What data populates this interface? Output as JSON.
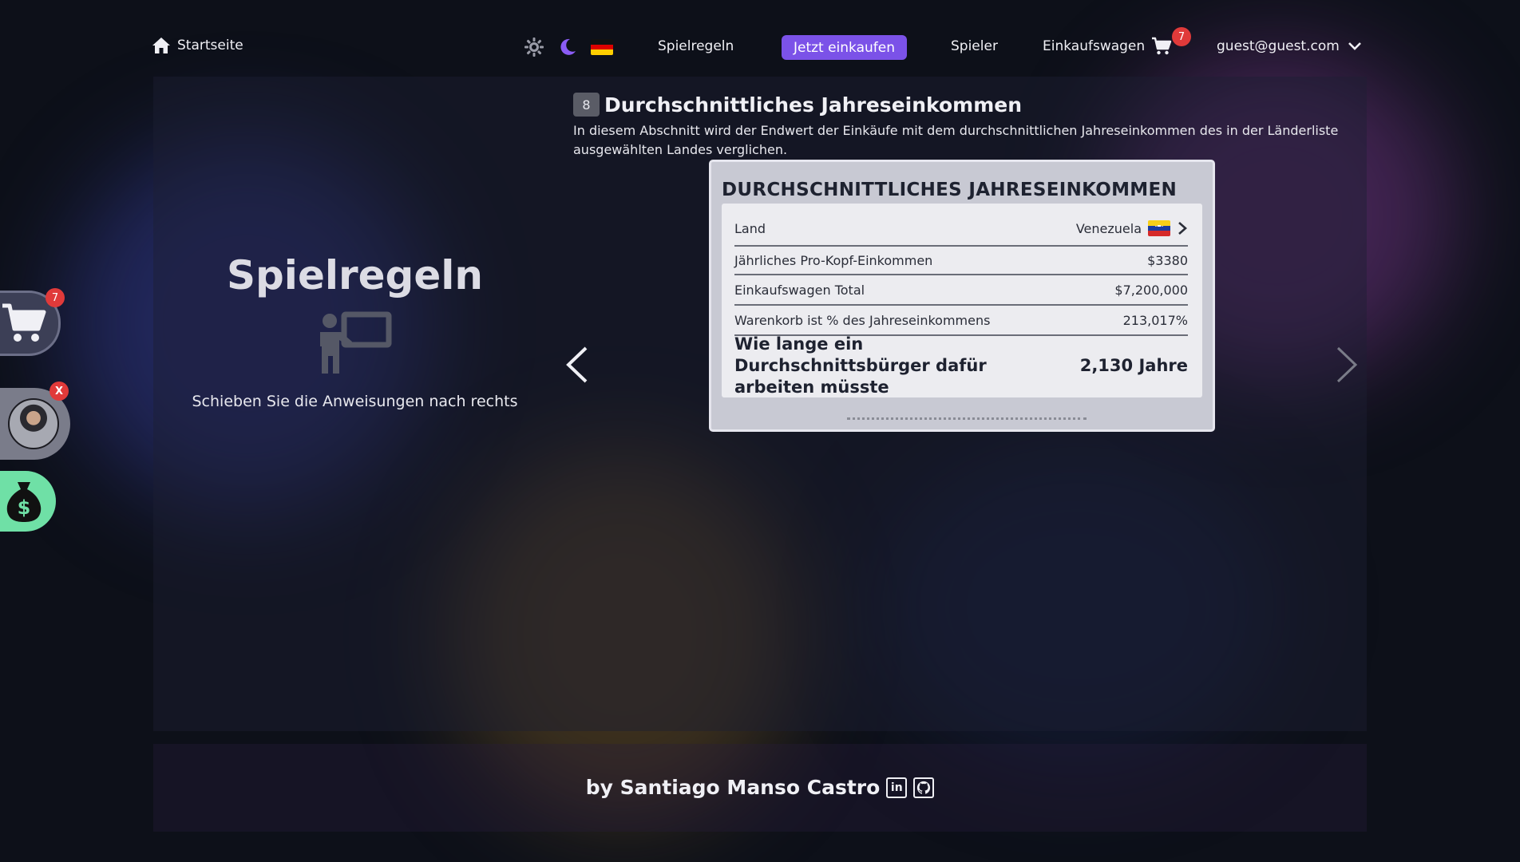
{
  "nav": {
    "home_label": "Startseite",
    "rules_label": "Spielregeln",
    "shop_label": "Jetzt einkaufen",
    "players_label": "Spieler",
    "cart_label": "Einkaufswagen",
    "cart_count": "7",
    "user_email": "guest@guest.com"
  },
  "rules_panel": {
    "title": "Spielregeln",
    "hint": "Schieben Sie die Anweisungen nach rechts"
  },
  "section": {
    "number": "8",
    "title": "Durchschnittliches Jahreseinkommen",
    "description": "In diesem Abschnitt wird der Endwert der Einkäufe mit dem durchschnittlichen Jahreseinkommen des in der Länderliste ausgewählten Landes verglichen."
  },
  "card": {
    "title": "DURCHSCHNITTLICHES JAHRESEINKOMMEN",
    "country_label": "Land",
    "country_value": "Venezuela",
    "rows": [
      {
        "label": "Jährliches Pro-Kopf-Einkommen",
        "value": "$3380"
      },
      {
        "label": "Einkaufswagen Total",
        "value": "$7,200,000"
      },
      {
        "label": "Warenkorb ist % des Jahreseinkommens",
        "value": "213,017%"
      }
    ],
    "summary_label": "Wie lange ein Durchschnittsbürger dafür arbeiten müsste",
    "summary_value": "2,130 Jahre"
  },
  "side": {
    "cart_count": "7",
    "player_badge": "X"
  },
  "footer": {
    "byline": "by Santiago Manso Castro",
    "linkedin_text": "in"
  },
  "colors": {
    "accent": "#7b52e8",
    "badge": "#e03a3a",
    "money": "#6fe0a6"
  }
}
